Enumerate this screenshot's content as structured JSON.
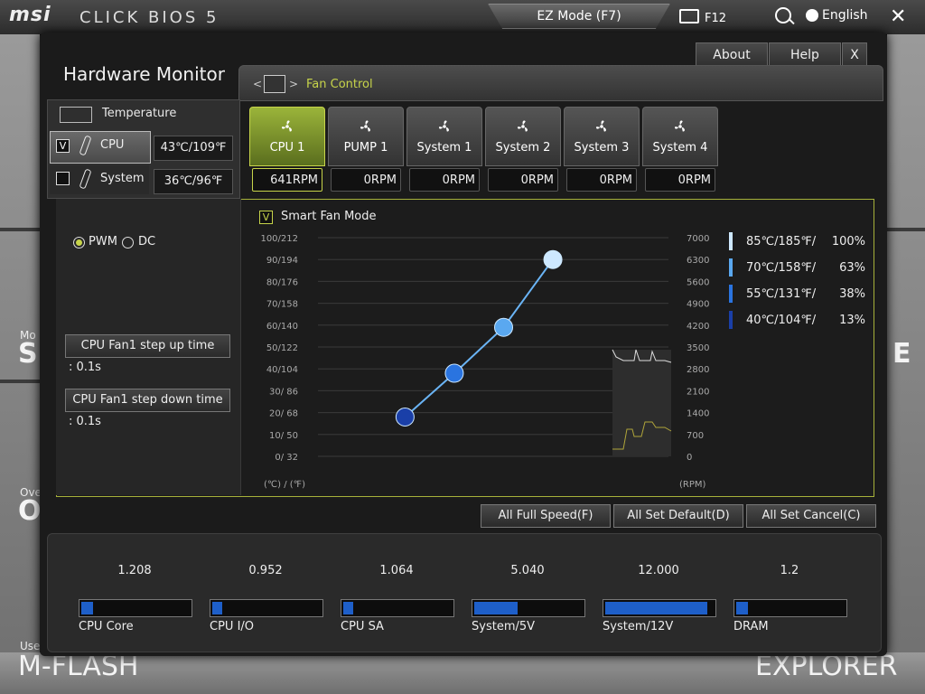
{
  "header": {
    "logo": "msi",
    "product": "CLICK BIOS 5",
    "ez_mode": "EZ Mode (F7)",
    "screenshot": "F12",
    "language": "English",
    "close": "✕"
  },
  "background": {
    "left_label_1": "SI",
    "left_label_2": "O",
    "mflash_small": "Use",
    "mflash": "M-FLASH",
    "explorer": "EXPLORER",
    "right_label": "E",
    "left_small_1": "Mo",
    "left_small_2": "Ove"
  },
  "dialog": {
    "title": "Hardware Monitor",
    "about": "About",
    "help": "Help",
    "close": "X",
    "tab_label": "Fan Control",
    "tab_prev": "<",
    "tab_next": ">"
  },
  "temperature": {
    "heading": "Temperature",
    "sensors": [
      {
        "name": "CPU",
        "value": "43℃/109℉",
        "checked": true,
        "check_mark": "V"
      },
      {
        "name": "System",
        "value": "36℃/96℉",
        "checked": false,
        "check_mark": ""
      }
    ]
  },
  "fans": [
    {
      "name": "CPU 1",
      "rpm": "641RPM",
      "active": true
    },
    {
      "name": "PUMP 1",
      "rpm": "0RPM",
      "active": false
    },
    {
      "name": "System 1",
      "rpm": "0RPM",
      "active": false
    },
    {
      "name": "System 2",
      "rpm": "0RPM",
      "active": false
    },
    {
      "name": "System 3",
      "rpm": "0RPM",
      "active": false
    },
    {
      "name": "System 4",
      "rpm": "0RPM",
      "active": false
    }
  ],
  "controls": {
    "pwm": "PWM",
    "dc": "DC",
    "mode_selected": "PWM",
    "step_up_label": "CPU Fan1 step up time",
    "step_up_value": ": 0.1s",
    "step_down_label": "CPU Fan1 step down time",
    "step_down_value": ": 0.1s",
    "smart_fan_label": "Smart Fan Mode",
    "smart_fan_checked": true,
    "smart_fan_mark": "V"
  },
  "legend": [
    {
      "temp": "85℃/185℉/",
      "pct": "100%",
      "color": "#cde8ff"
    },
    {
      "temp": "70℃/158℉/",
      "pct": "63%",
      "color": "#5aa8f0"
    },
    {
      "temp": "55℃/131℉/",
      "pct": "38%",
      "color": "#2a74e0"
    },
    {
      "temp": "40℃/104℉/",
      "pct": "13%",
      "color": "#1a3fa8"
    }
  ],
  "actions": {
    "full_speed": "All Full Speed(F)",
    "set_default": "All Set Default(D)",
    "set_cancel": "All Set Cancel(C)"
  },
  "voltages": [
    {
      "name": "CPU Core",
      "value": "1.208",
      "fill": 0.11
    },
    {
      "name": "CPU I/O",
      "value": "0.952",
      "fill": 0.09
    },
    {
      "name": "CPU SA",
      "value": "1.064",
      "fill": 0.09
    },
    {
      "name": "System/5V",
      "value": "5.040",
      "fill": 0.4
    },
    {
      "name": "System/12V",
      "value": "12.000",
      "fill": 0.94
    },
    {
      "name": "DRAM",
      "value": "1.2",
      "fill": 0.11
    }
  ],
  "chart_data": {
    "type": "line",
    "left_axis_ticks": [
      "100/212",
      "90/194",
      "80/176",
      "70/158",
      "60/140",
      "50/122",
      "40/104",
      "30/ 86",
      "20/ 68",
      "10/ 50",
      "0/ 32"
    ],
    "right_axis_ticks": [
      "7000",
      "6300",
      "5600",
      "4900",
      "4200",
      "3500",
      "2800",
      "2100",
      "1400",
      "700",
      "0"
    ],
    "left_unit": "(℃) / (℉)",
    "right_unit": "(RPM)",
    "ylim": [
      0,
      100
    ],
    "x": [
      40,
      55,
      70,
      85
    ],
    "y": [
      18,
      38,
      59,
      90
    ],
    "xlabel": "(℃)",
    "ylabel": "(RPM)"
  }
}
